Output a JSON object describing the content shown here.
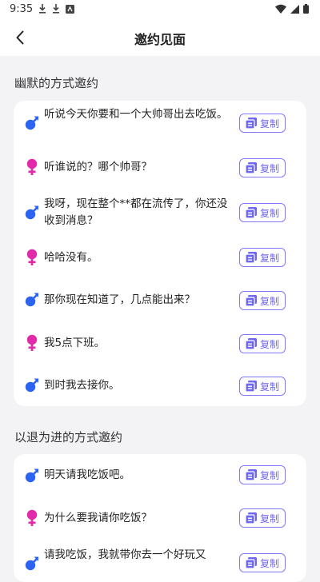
{
  "status": {
    "time": "9:35"
  },
  "header": {
    "title": "邀约见面",
    "back_icon": "chevron-left-icon"
  },
  "colors": {
    "male": "#2c63f0",
    "female": "#e02aa9",
    "accent": "#6f67ee",
    "background": "#f3f3f6",
    "card": "#ffffff"
  },
  "sections": [
    {
      "title": "幽默的方式邀约",
      "items": [
        {
          "gender": "male",
          "text": "听说今天你要和一个大帅哥出去吃饭。",
          "copy_label": "复制"
        },
        {
          "gender": "female",
          "text": "听谁说的？哪个帅哥？",
          "copy_label": "复制"
        },
        {
          "gender": "male",
          "text": "我呀，现在整个**都在流传了，你还没收到消息？",
          "copy_label": "复制"
        },
        {
          "gender": "female",
          "text": "哈哈没有。",
          "copy_label": "复制"
        },
        {
          "gender": "male",
          "text": "那你现在知道了，几点能出来？",
          "copy_label": "复制"
        },
        {
          "gender": "female",
          "text": "我5点下班。",
          "copy_label": "复制"
        },
        {
          "gender": "male",
          "text": "到时我去接你。",
          "copy_label": "复制"
        }
      ]
    },
    {
      "title": "以退为进的方式邀约",
      "items": [
        {
          "gender": "male",
          "text": "明天请我吃饭吧。",
          "copy_label": "复制"
        },
        {
          "gender": "female",
          "text": "为什么要我请你吃饭？",
          "copy_label": "复制"
        },
        {
          "gender": "male",
          "text": "请我吃饭，我就带你去一个好玩又",
          "copy_label": "复制"
        }
      ]
    }
  ]
}
